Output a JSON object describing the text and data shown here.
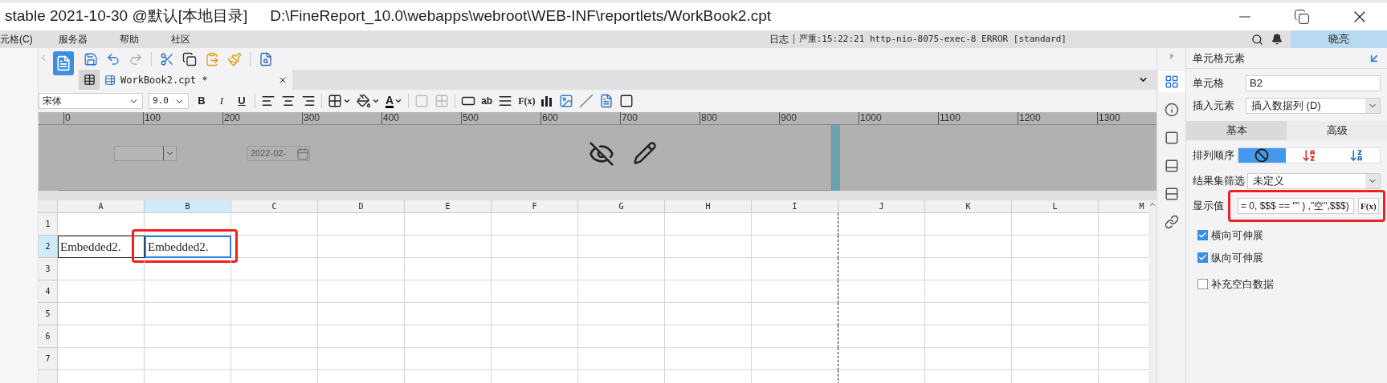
{
  "window": {
    "title": "stable 2021-10-30 @默认[本地目录]",
    "path": "D:\\FineReport_10.0\\webapps\\webroot\\WEB-INF\\reportlets/WorkBook2.cpt"
  },
  "menu": [
    "元格(C)",
    "服务器",
    "帮助",
    "社区"
  ],
  "log": {
    "label": "日志",
    "message": "严重:15:22:21 http-nio-8075-exec-8 ERROR [standard]"
  },
  "user": "晓亮",
  "file_tab": {
    "label": "WorkBook2.cpt *"
  },
  "format_toolbar": {
    "font": "宋体",
    "size": "9.0",
    "style_buttons": [
      "B",
      "I",
      "U"
    ],
    "font_color_label": "A",
    "text_label": "ab",
    "formula_label": "F(x)"
  },
  "ruler": [
    "0",
    "100",
    "200",
    "300",
    "400",
    "500",
    "600",
    "700",
    "800",
    "900",
    "1000",
    "1100",
    "1200",
    "1300"
  ],
  "canvas": {
    "date_value": "2022-02-"
  },
  "columns": [
    {
      "label": "A",
      "selected": false
    },
    {
      "label": "B",
      "selected": true
    },
    {
      "label": "C",
      "selected": false
    },
    {
      "label": "D",
      "selected": false
    },
    {
      "label": "E",
      "selected": false
    },
    {
      "label": "F",
      "selected": false
    },
    {
      "label": "G",
      "selected": false
    },
    {
      "label": "H",
      "selected": false
    },
    {
      "label": "I",
      "selected": false
    },
    {
      "label": "J",
      "selected": false
    },
    {
      "label": "K",
      "selected": false
    },
    {
      "label": "L",
      "selected": false
    },
    {
      "label": "M",
      "selected": false
    }
  ],
  "rows": [
    {
      "label": "1",
      "selected": false
    },
    {
      "label": "2",
      "selected": true,
      "cells": [
        {
          "text": "Embedded2.",
          "selected": false
        },
        {
          "text": "Embedded2.",
          "selected": true
        }
      ]
    },
    {
      "label": "3",
      "selected": false
    },
    {
      "label": "4",
      "selected": false
    },
    {
      "label": "5",
      "selected": false
    },
    {
      "label": "6",
      "selected": false
    },
    {
      "label": "7",
      "selected": false
    }
  ],
  "side_icons": [
    {
      "kind": "cell",
      "selected": true
    },
    {
      "kind": "attributes",
      "selected": false
    },
    {
      "kind": "border",
      "selected": false
    },
    {
      "kind": "widget",
      "selected": false
    },
    {
      "kind": "condition",
      "selected": false
    },
    {
      "kind": "link",
      "selected": false
    }
  ],
  "panel": {
    "title": "单元格元素",
    "cell": {
      "label": "单元格",
      "value": "B2"
    },
    "insert": {
      "label": "插入元素",
      "value": "插入数据列 (D)"
    },
    "tabs": [
      {
        "label": "基本",
        "selected": true
      },
      {
        "label": "高级",
        "selected": false
      }
    ],
    "sort": {
      "label": "排列顺序",
      "options": [
        {
          "kind": "none",
          "selected": true
        },
        {
          "kind": "asc",
          "selected": false
        },
        {
          "kind": "desc",
          "selected": false
        }
      ]
    },
    "filter": {
      "label": "结果集筛选",
      "value": "未定义"
    },
    "display": {
      "label": "显示值",
      "value": "= 0, $$$ == \"\" ) ,\"空\",$$$)",
      "button": "F(x)"
    },
    "options": [
      {
        "label": "横向可伸展",
        "checked": true
      },
      {
        "label": "纵向可伸展",
        "checked": true
      },
      {
        "label": "补充空白数据",
        "checked": false
      }
    ]
  }
}
